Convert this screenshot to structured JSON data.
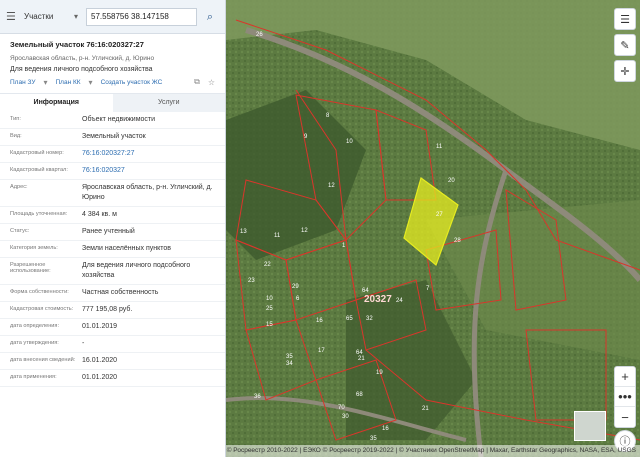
{
  "search": {
    "category": "Участки",
    "query": "57.558756 38.147158"
  },
  "parcel": {
    "title": "Земельный участок 76:16:020327:27",
    "address_short": "Ярославская область, р-н. Угличский, д. Юрино",
    "purpose": "Для ведения личного подсобного хозяйства",
    "links": [
      "План ЗУ",
      "План КК",
      "Создать участок ЖС"
    ]
  },
  "tabs": [
    "Информация",
    "Услуги"
  ],
  "info_rows": [
    {
      "key": "Тип:",
      "value": "Объект недвижимости"
    },
    {
      "key": "Вид:",
      "value": "Земельный участок"
    },
    {
      "key": "Кадастровый номер:",
      "value": "76:16:020327:27"
    },
    {
      "key": "Кадастровый квартал:",
      "value": "76:16:020327"
    },
    {
      "key": "Адрес:",
      "value": "Ярославская область, р-н. Угличский, д. Юрино"
    },
    {
      "key": "Площадь уточненная:",
      "value": "4 384 кв. м"
    },
    {
      "key": "Статус:",
      "value": "Ранее учтенный"
    },
    {
      "key": "Категория земель:",
      "value": "Земли населённых пунктов"
    },
    {
      "key": "Разрешенное использование:",
      "value": "Для ведения личного подсобного хозяйства"
    },
    {
      "key": "Форма собственности:",
      "value": "Частная собственность"
    },
    {
      "key": "Кадастровая стоимость:",
      "value": "777 195,08 руб."
    },
    {
      "key": "дата определения:",
      "value": "01.01.2019"
    },
    {
      "key": "дата утверждения:",
      "value": "-"
    },
    {
      "key": "дата внесения сведений:",
      "value": "16.01.2020"
    },
    {
      "key": "дата применения:",
      "value": "01.01.2020"
    }
  ],
  "map": {
    "attribution": "ПКК © Росреестр 2010-2022 | ЕЭКО © Росреестр 2019-2022 | © Участники OpenStreetMap | Maxar, Earthstar Geographics, NASA, ESA, USGS",
    "controls": {
      "zoom_in": "+",
      "more": "•••",
      "zoom_out": "−"
    },
    "labels": {
      "road": "26",
      "quarter": "20327",
      "parcels": [
        "9",
        "8",
        "10",
        "11",
        "12",
        "27",
        "20",
        "28",
        "11",
        "12",
        "1",
        "13",
        "22",
        "29",
        "23",
        "65",
        "32",
        "64",
        "24",
        "25",
        "15",
        "16",
        "17",
        "21",
        "35",
        "64",
        "34",
        "19",
        "68",
        "70",
        "36",
        "16",
        "30",
        "35",
        "21",
        "7",
        "6",
        "10"
      ]
    },
    "colors": {
      "boundary": "#d9362b",
      "selected": "#e6ec20"
    }
  }
}
